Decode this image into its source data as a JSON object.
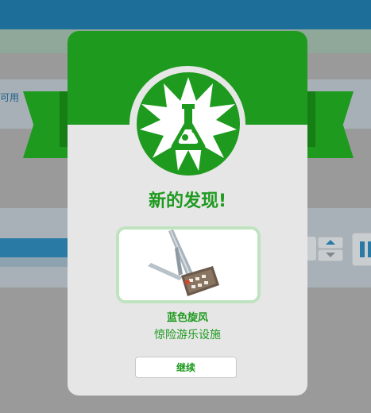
{
  "background": {
    "left_text": "可用"
  },
  "dialog": {
    "title": "新的发现!",
    "badge_icon": "flask-icon",
    "item": {
      "name": "蓝色旋风",
      "type": "惊险游乐设施"
    },
    "continue_label": "继续"
  },
  "colors": {
    "accent_green": "#1e9a1e",
    "dialog_bg": "#e6e6e6",
    "card_border": "#bfe3bf"
  }
}
